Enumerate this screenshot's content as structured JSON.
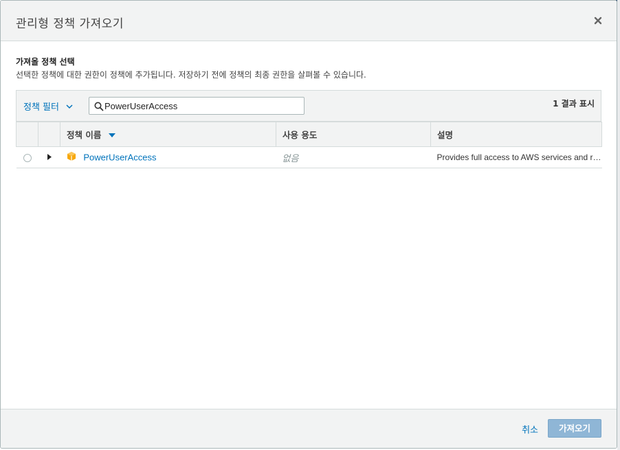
{
  "modal": {
    "title": "관리형 정책 가져오기",
    "close_icon": "close-icon"
  },
  "section": {
    "title": "가져올 정책 선택",
    "description": "선택한 정책에 대한 권한이 정책에 추가됩니다. 저장하기 전에 정책의 최종 권한을 살펴볼 수 있습니다."
  },
  "filter": {
    "dropdown_label": "정책 필터",
    "search_value": "PowerUserAccess",
    "result_count": "1 결과 표시"
  },
  "table": {
    "columns": {
      "name": "정책 이름",
      "usage": "사용 용도",
      "description": "설명"
    },
    "rows": [
      {
        "name": "PowerUserAccess",
        "usage": "없음",
        "description": "Provides full access to AWS services and resources, but does not allow management of Users and groups."
      }
    ]
  },
  "footer": {
    "cancel_label": "취소",
    "import_label": "가져오기"
  },
  "colors": {
    "link": "#0073bb",
    "header_bg": "#f2f3f3",
    "primary_disabled": "#8fb6d6",
    "policy_icon": "#f7a80d"
  }
}
